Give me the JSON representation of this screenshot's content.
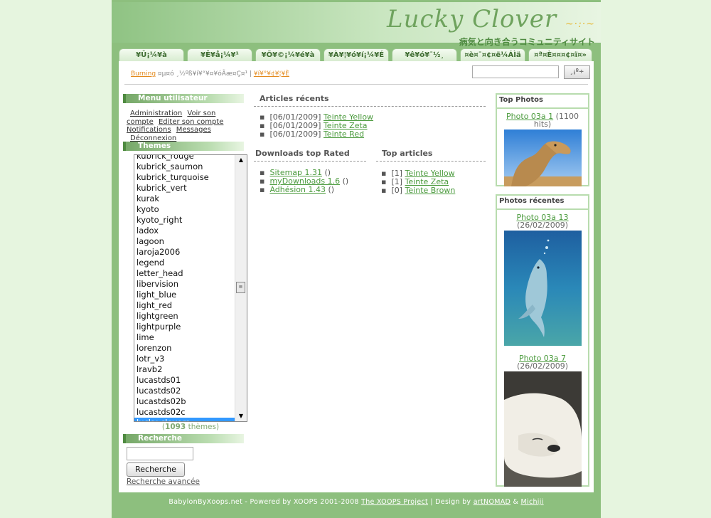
{
  "header": {
    "logo_text": "Lucky Clover",
    "logo_flourish": "~·:·~",
    "logo_subtitle": "病気と向き合うコミュニティサイト"
  },
  "tabs": [
    "¥Û¡¼¥à",
    "¥Ë¥å¡¼¥¹",
    "¥Õ¥©¡¼¥é¥à",
    "¥À¥¦¥ó¥í¡¼¥É",
    "¥ê¥ó¥¯½¸",
    "¤è¤¯¤¢¤ë¼ÁÌä",
    "¤ª¤È¤¤¤¢¤ï¤»"
  ],
  "breadcrumb": {
    "link1": "Burning",
    "middle": "¤µ¤ó ¸½ºß¥í¥°¥¤¥óÃæ¤Ç¤¹ |",
    "link2": "¥í¥°¥¢¥¦¥È"
  },
  "top_search": {
    "button": "¸¡º÷"
  },
  "user_menu": {
    "title": "Menu utilisateur",
    "items": [
      "Administration",
      "Voir son compte",
      "Editer son compte",
      "Notifications",
      "Messages",
      "Déconnexion"
    ]
  },
  "themes": {
    "title": "Themes",
    "list": [
      "kubrick_rouge",
      "kubrick_saumon",
      "kubrick_turquoise",
      "kubrick_vert",
      "kurak",
      "kyoto",
      "kyoto_right",
      "ladox",
      "lagoon",
      "laroja2006",
      "legend",
      "letter_head",
      "libervision",
      "light_blue",
      "light_red",
      "lightgreen",
      "lightpurple",
      "lime",
      "lorenzon",
      "lotr_v3",
      "lravb2",
      "lucastds01",
      "lucastds02",
      "lucastds02b",
      "lucastds02c",
      "lucky-clovers"
    ],
    "selected": "lucky-clovers",
    "count_open": "(",
    "count": "1093",
    "count_suffix": "thèmes)"
  },
  "search_block": {
    "title": "Recherche",
    "button": "Recherche",
    "advanced": "Recherche avancée"
  },
  "recent_articles": {
    "title": "Articles récents",
    "items": [
      {
        "date": "[06/01/2009]",
        "title": "Teinte Yellow"
      },
      {
        "date": "[06/01/2009]",
        "title": "Teinte Zeta"
      },
      {
        "date": "[06/01/2009]",
        "title": "Teinte Red"
      }
    ]
  },
  "downloads": {
    "title": "Downloads top Rated",
    "items": [
      {
        "title": "Sitemap 1.31",
        "extra": "()"
      },
      {
        "title": "myDownloads 1.6",
        "extra": "()"
      },
      {
        "title": "Adhésion 1.43",
        "extra": "()"
      }
    ]
  },
  "top_articles": {
    "title": "Top articles",
    "items": [
      {
        "count": "[1]",
        "title": "Teinte Yellow"
      },
      {
        "count": "[1]",
        "title": "Teinte Zeta"
      },
      {
        "count": "[0]",
        "title": "Teinte Brown"
      }
    ]
  },
  "top_photos": {
    "title": "Top Photos",
    "items": [
      {
        "title": "Photo 03a 1",
        "meta": "(1100 hits)",
        "subject": "camel"
      }
    ]
  },
  "recent_photos": {
    "title": "Photos récentes",
    "items": [
      {
        "title": "Photo 03a 13",
        "meta": "(26/02/2009)",
        "subject": "dolphin"
      },
      {
        "title": "Photo 03a 7",
        "meta": "(26/02/2009)",
        "subject": "polar bear"
      }
    ]
  },
  "footer": {
    "prefix": "BabylonByXoops.net - Powered by XOOPS 2001-2008",
    "xoops_link": "The XOOPS Project",
    "sep": "|  Design by",
    "design1": "artNOMAD",
    "amp": "&",
    "design2": "Michiji"
  },
  "colors": {
    "page_bg": "#e6f5df",
    "frame": "#8dbf7e",
    "link": "#4a9a3c",
    "accent": "#e38a1d",
    "selection": "#3399ff"
  }
}
